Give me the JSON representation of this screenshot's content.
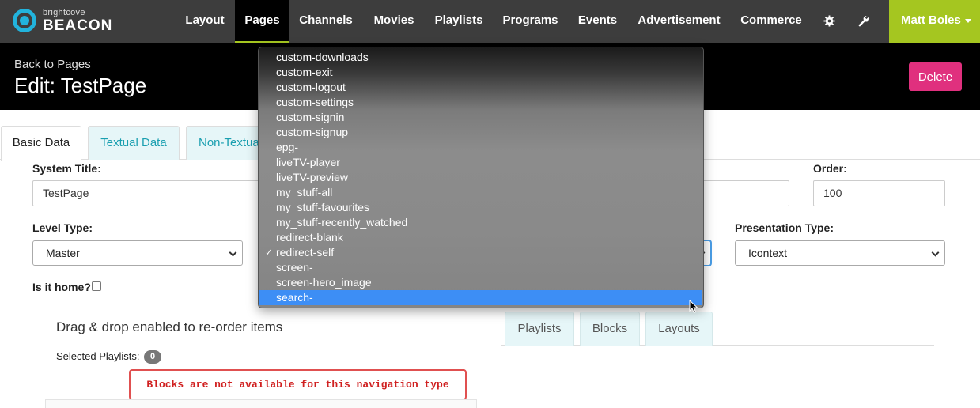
{
  "brand": {
    "small": "brightcove",
    "big": "BEACON"
  },
  "nav": {
    "items": [
      "Layout",
      "Pages",
      "Channels",
      "Movies",
      "Playlists",
      "Programs",
      "Events",
      "Advertisement",
      "Commerce"
    ],
    "active": "Pages",
    "settings_icon": "gear-icon",
    "tools_icon": "wrench-icon",
    "user": "Matt Boles"
  },
  "header": {
    "back": "Back to Pages",
    "title": "Edit: TestPage",
    "delete": "Delete"
  },
  "tabs": [
    "Basic Data",
    "Textual Data",
    "Non-Textua"
  ],
  "form": {
    "system_title_label": "System Title:",
    "system_title_value": "TestPage",
    "order_label": "Order:",
    "order_value": "100",
    "level_type_label": "Level Type:",
    "level_type_value": "Master",
    "presentation_type_label": "Presentation Type:",
    "presentation_type_value": "Icontext",
    "is_home_label": "Is it home?"
  },
  "drag_text": "Drag & drop enabled to re-order items",
  "selected_playlists_label": "Selected Playlists:",
  "selected_playlists_count": "0",
  "warning": "Blocks are not available for this navigation type",
  "sub_tabs": [
    "Playlists",
    "Blocks",
    "Layouts"
  ],
  "dropdown": {
    "options": [
      "custom-downloads",
      "custom-exit",
      "custom-logout",
      "custom-settings",
      "custom-signin",
      "custom-signup",
      "epg-",
      "liveTV-player",
      "liveTV-preview",
      "my_stuff-all",
      "my_stuff-favourites",
      "my_stuff-recently_watched",
      "redirect-blank",
      "redirect-self",
      "screen-",
      "screen-hero_image",
      "search-"
    ],
    "checked": "redirect-self",
    "highlighted": "search-",
    "check_mark": "✓"
  },
  "colors": {
    "nav_bg": "#3d3d3d",
    "accent": "#a5c620",
    "delete": "#e0307e",
    "tab_text": "#1a9fb0",
    "highlight": "#3d8ef5"
  }
}
